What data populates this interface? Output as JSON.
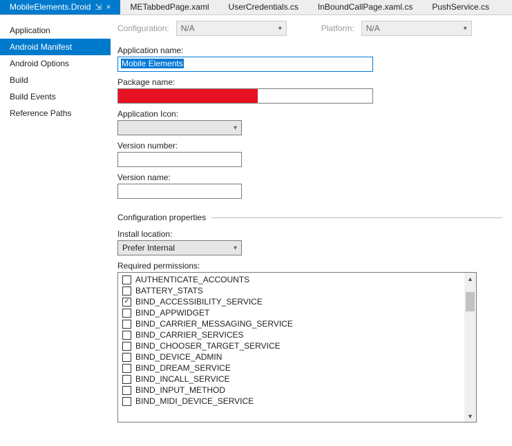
{
  "tabs": [
    {
      "label": "MobileElements.Droid",
      "active": true,
      "pinned": true,
      "closable": true
    },
    {
      "label": "METabbedPage.xaml"
    },
    {
      "label": "UserCredentials.cs"
    },
    {
      "label": "InBoundCallPage.xaml.cs"
    },
    {
      "label": "PushService.cs"
    }
  ],
  "sidebar": {
    "items": [
      {
        "label": "Application"
      },
      {
        "label": "Android Manifest",
        "active": true
      },
      {
        "label": "Android Options"
      },
      {
        "label": "Build"
      },
      {
        "label": "Build Events"
      },
      {
        "label": "Reference Paths"
      }
    ]
  },
  "toprow": {
    "config_label": "Configuration:",
    "config_value": "N/A",
    "platform_label": "Platform:",
    "platform_value": "N/A"
  },
  "fields": {
    "app_name_label": "Application name:",
    "app_name_value": "Mobile Elements",
    "package_label": "Package name:",
    "icon_label": "Application Icon:",
    "icon_value": "",
    "version_number_label": "Version number:",
    "version_number_value": "",
    "version_name_label": "Version name:",
    "version_name_value": ""
  },
  "section_title": "Configuration properties",
  "install": {
    "label": "Install location:",
    "value": "Prefer Internal"
  },
  "permissions": {
    "label": "Required permissions:",
    "items": [
      {
        "name": "AUTHENTICATE_ACCOUNTS",
        "checked": false
      },
      {
        "name": "BATTERY_STATS",
        "checked": false
      },
      {
        "name": "BIND_ACCESSIBILITY_SERVICE",
        "checked": true
      },
      {
        "name": "BIND_APPWIDGET",
        "checked": false
      },
      {
        "name": "BIND_CARRIER_MESSAGING_SERVICE",
        "checked": false
      },
      {
        "name": "BIND_CARRIER_SERVICES",
        "checked": false
      },
      {
        "name": "BIND_CHOOSER_TARGET_SERVICE",
        "checked": false
      },
      {
        "name": "BIND_DEVICE_ADMIN",
        "checked": false
      },
      {
        "name": "BIND_DREAM_SERVICE",
        "checked": false
      },
      {
        "name": "BIND_INCALL_SERVICE",
        "checked": false
      },
      {
        "name": "BIND_INPUT_METHOD",
        "checked": false
      },
      {
        "name": "BIND_MIDI_DEVICE_SERVICE",
        "checked": false
      }
    ]
  }
}
